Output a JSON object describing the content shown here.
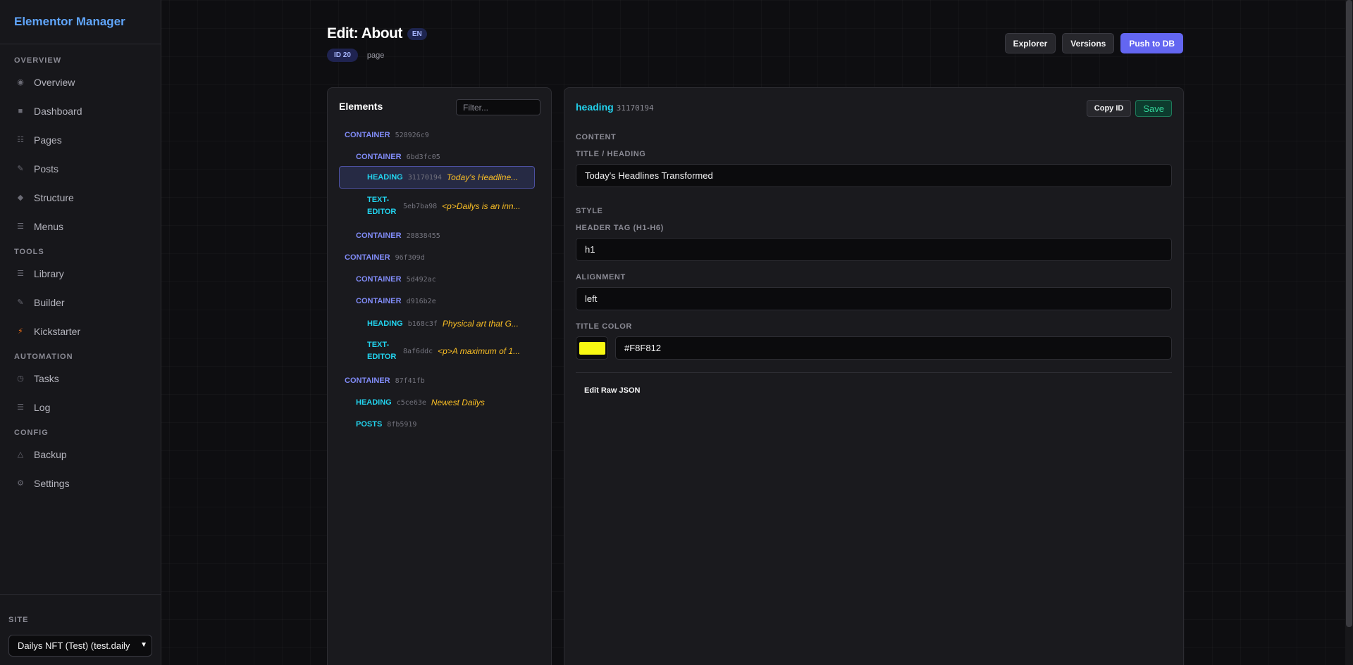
{
  "brand": "Elementor Manager",
  "sidebar": {
    "sections": [
      {
        "label": "OVERVIEW",
        "items": [
          {
            "label": "Overview",
            "icon": "target-icon"
          },
          {
            "label": "Dashboard",
            "icon": "square-icon"
          },
          {
            "label": "Pages",
            "icon": "list-grid-icon"
          },
          {
            "label": "Posts",
            "icon": "pencil-icon"
          },
          {
            "label": "Structure",
            "icon": "diamond-icon"
          },
          {
            "label": "Menus",
            "icon": "hamburger-icon"
          }
        ]
      },
      {
        "label": "TOOLS",
        "items": [
          {
            "label": "Library",
            "icon": "hamburger-icon"
          },
          {
            "label": "Builder",
            "icon": "pencil-icon"
          },
          {
            "label": "Kickstarter",
            "icon": "bolt-icon"
          }
        ]
      },
      {
        "label": "AUTOMATION",
        "items": [
          {
            "label": "Tasks",
            "icon": "clock-icon"
          },
          {
            "label": "Log",
            "icon": "hamburger-icon"
          }
        ]
      },
      {
        "label": "CONFIG",
        "items": [
          {
            "label": "Backup",
            "icon": "triangle-icon"
          },
          {
            "label": "Settings",
            "icon": "gear-icon"
          }
        ]
      }
    ],
    "site_label": "SITE",
    "site_value": "Dailys NFT (Test) (test.daily"
  },
  "header": {
    "title": "Edit: About",
    "lang": "EN",
    "id_badge": "ID 20",
    "type": "page",
    "explorer_label": "Explorer",
    "versions_label": "Versions",
    "push_label": "Push to DB"
  },
  "elements": {
    "title": "Elements",
    "filter_placeholder": "Filter...",
    "tree": [
      {
        "type": "CONTAINER",
        "id": "528926c9",
        "preview": ""
      },
      {
        "type": "CONTAINER",
        "id": "6bd3fc05",
        "preview": ""
      },
      {
        "type": "HEADING",
        "id": "31170194",
        "preview": "Today's Headline..."
      },
      {
        "type": "TEXT-EDITOR",
        "id": "5eb7ba98",
        "preview": "<p>Dailys is an inn..."
      },
      {
        "type": "CONTAINER",
        "id": "28838455",
        "preview": ""
      },
      {
        "type": "CONTAINER",
        "id": "96f309d",
        "preview": ""
      },
      {
        "type": "CONTAINER",
        "id": "5d492ac",
        "preview": ""
      },
      {
        "type": "CONTAINER",
        "id": "d916b2e",
        "preview": ""
      },
      {
        "type": "HEADING",
        "id": "b168c3f",
        "preview": "Physical art that G..."
      },
      {
        "type": "TEXT-EDITOR",
        "id": "8af6ddc",
        "preview": "<p>A maximum of 1..."
      },
      {
        "type": "CONTAINER",
        "id": "87f41fb",
        "preview": ""
      },
      {
        "type": "HEADING",
        "id": "c5ce63e",
        "preview": "Newest Dailys"
      },
      {
        "type": "POSTS",
        "id": "8fb5919",
        "preview": ""
      }
    ]
  },
  "editor": {
    "widget_type": "heading",
    "widget_id": "31170194",
    "copy_id_label": "Copy ID",
    "save_label": "Save",
    "content_section": "CONTENT",
    "title_label": "TITLE / HEADING",
    "title_value": "Today's Headlines Transformed",
    "style_section": "STYLE",
    "tag_label": "HEADER TAG (H1-H6)",
    "tag_value": "h1",
    "align_label": "ALIGNMENT",
    "align_value": "left",
    "color_label": "TITLE COLOR",
    "color_value": "#F8F812",
    "raw_json_label": "Edit Raw JSON"
  },
  "colors": {
    "accent": "#6366f1",
    "brand": "#60a5fa",
    "container": "#818cf8",
    "widget": "#22d3ee",
    "preview": "#fbbf24",
    "save": "#34d399"
  }
}
